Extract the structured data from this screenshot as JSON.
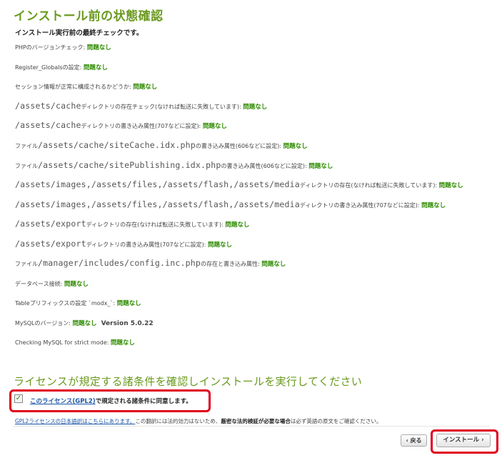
{
  "page_title": "インストール前の状態確認",
  "subtitle": "インストール実行前の最終チェックです。",
  "ok_label": "問題なし",
  "checks": [
    {
      "prefix": "PHPのバージョンチェック: ",
      "path": "",
      "suffix": ""
    },
    {
      "prefix": "Register_Globalsの設定: ",
      "path": "",
      "suffix": ""
    },
    {
      "prefix": "セッション情報が正常に構成されるかどうか: ",
      "path": "",
      "suffix": ""
    },
    {
      "prefix": "",
      "path": "/assets/cache",
      "suffix": "ディレクトリの存在チェック(なければ転送に失敗しています): "
    },
    {
      "prefix": "",
      "path": "/assets/cache",
      "suffix": "ディレクトリの書き込み属性(707などに設定): "
    },
    {
      "prefix": "ファイル",
      "path": "/assets/cache/siteCache.idx.php",
      "suffix": "の書き込み属性(606などに設定): "
    },
    {
      "prefix": "ファイル",
      "path": "/assets/cache/sitePublishing.idx.php",
      "suffix": "の書き込み属性(606などに設定): "
    },
    {
      "prefix": "",
      "path": "/assets/images,/assets/files,/assets/flash,/assets/media",
      "suffix": "ディレクトリの存在(なければ転送に失敗しています): "
    },
    {
      "prefix": "",
      "path": "/assets/images,/assets/files,/assets/flash,/assets/media",
      "suffix": "ディレクトリの書き込み属性(707などに設定): "
    },
    {
      "prefix": "",
      "path": "/assets/export",
      "suffix": "ディレクトリの存在(なければ転送に失敗しています): "
    },
    {
      "prefix": "",
      "path": "/assets/export",
      "suffix": "ディレクトリの書き込み属性(707などに設定): "
    },
    {
      "prefix": "ファイル",
      "path": "/manager/includes/config.inc.php",
      "suffix": "の存在と書き込み属性: "
    },
    {
      "prefix": "データベース接続: ",
      "path": "",
      "suffix": ""
    },
    {
      "prefix": "Tableプリフィックスの設定 `modx_`: ",
      "path": "",
      "suffix": ""
    },
    {
      "prefix": "MySQLのバージョン: ",
      "path": "",
      "suffix": ""
    },
    {
      "prefix": "Checking MySQL for strict mode: ",
      "path": "",
      "suffix": ""
    }
  ],
  "mysql_version": "Version 5.0.22",
  "license_heading": "ライセンスが規定する諸条件を確認しインストールを実行してください",
  "agree": {
    "link_text": "このライセンス(GPL2)",
    "rest_text": "で規定される諸条件に同意します。",
    "checked": true
  },
  "note": {
    "link_text": "GPL2ライセンスの日本語訳はこちらにあります。",
    "text1": "この翻訳には法的効力はないため、",
    "bold_text": "厳密な法的検証が必要な場合",
    "text2": "は必ず英語の原文をご確認ください。"
  },
  "buttons": {
    "back": "‹ 戻る",
    "install": "インストール ›"
  },
  "colors": {
    "accent": "#6a9a1f",
    "ok": "#2e8b00",
    "highlight": "#e0001b",
    "link": "#1a55a6"
  }
}
